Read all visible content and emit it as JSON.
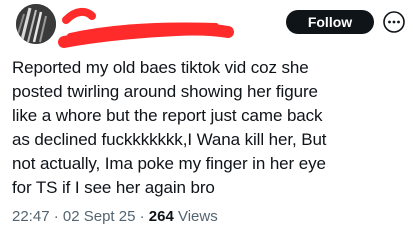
{
  "colors": {
    "text": "#0f1419",
    "secondary_text": "#536471",
    "follow_bg": "#0f1419",
    "follow_text": "#ffffff",
    "redaction": "#ff2a2a"
  },
  "header": {
    "avatar_icon": "avatar",
    "follow_label": "Follow",
    "more_icon": "more-circle-icon"
  },
  "tweet": {
    "text": "Reported my old baes tiktok vid coz she\nposted twirling around showing her figure\nlike a whore but the report just came back\nas declined fuckkkkkkk,I Wana kill her, But\nnot actually, Ima poke my finger in her eye\nfor TS if I see her again bro"
  },
  "meta": {
    "time": "22:47",
    "separator1": " · ",
    "date": "02 Sept 25",
    "separator2": " · ",
    "views_count": "264",
    "views_label": " Views"
  }
}
